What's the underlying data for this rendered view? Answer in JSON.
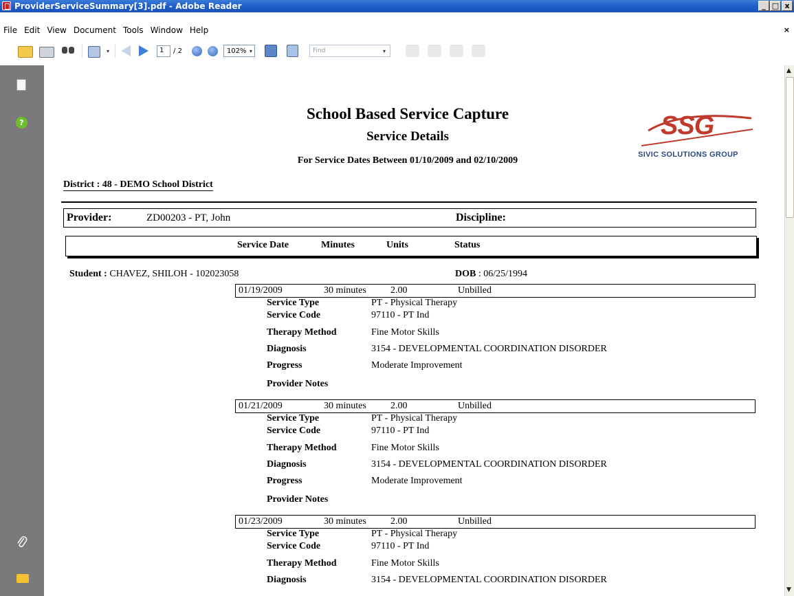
{
  "window": {
    "title": "ProviderServiceSummary[3].pdf - Adobe Reader",
    "buttons": [
      "_",
      "□",
      "x"
    ]
  },
  "menu": {
    "items": [
      "File",
      "Edit",
      "View",
      "Document",
      "Tools",
      "Window",
      "Help"
    ],
    "doc_close": "×"
  },
  "toolbar": {
    "current_page": "1",
    "page_total": "/ 2",
    "zoom": "102%",
    "find_placeholder": "Find",
    "dropdown_arrow": "▾"
  },
  "report": {
    "title": "School Based Service Capture",
    "subtitle": "Service Details",
    "date_range": "For Service Dates Between 01/10/2009 and 02/10/2009",
    "logo_text": "SSG",
    "logo_tagline": "SIVIC SOLUTIONS GROUP",
    "district": "District : 48 - DEMO School District",
    "provider_label": "Provider:",
    "provider_value": "ZD00203 - PT, John",
    "discipline_label": "Discipline:",
    "columns": [
      "Service Date",
      "Minutes",
      "Units",
      "Status"
    ],
    "student_label": "Student :",
    "student_value": "CHAVEZ, SHILOH - 102023058",
    "dob_label": "DOB",
    "dob_value": ":  06/25/1994",
    "detail_labels": {
      "service_type": "Service Type",
      "service_code": "Service Code",
      "therapy_method": "Therapy Method",
      "diagnosis": "Diagnosis",
      "progress": "Progress",
      "provider_notes": "Provider Notes"
    },
    "services": [
      {
        "date": "01/19/2009",
        "minutes": "30 minutes",
        "units": "2.00",
        "status": "Unbilled",
        "service_type": "PT - Physical Therapy",
        "service_code": "97110 - PT Ind",
        "therapy_method": "Fine Motor Skills",
        "diagnosis": "3154 - DEVELOPMENTAL COORDINATION DISORDER",
        "progress": "Moderate Improvement"
      },
      {
        "date": "01/21/2009",
        "minutes": "30 minutes",
        "units": "2.00",
        "status": "Unbilled",
        "service_type": "PT - Physical Therapy",
        "service_code": "97110 - PT Ind",
        "therapy_method": "Fine Motor Skills",
        "diagnosis": "3154 - DEVELOPMENTAL COORDINATION DISORDER",
        "progress": "Moderate Improvement"
      },
      {
        "date": "01/23/2009",
        "minutes": "30 minutes",
        "units": "2.00",
        "status": "Unbilled",
        "service_type": "PT - Physical Therapy",
        "service_code": "97110 - PT Ind",
        "therapy_method": "Fine Motor Skills",
        "diagnosis": "3154 - DEVELOPMENTAL COORDINATION DISORDER"
      }
    ]
  },
  "icons": {
    "help": "?",
    "attach": "📎",
    "scroll_up": "▲",
    "scroll_down": "▼"
  }
}
